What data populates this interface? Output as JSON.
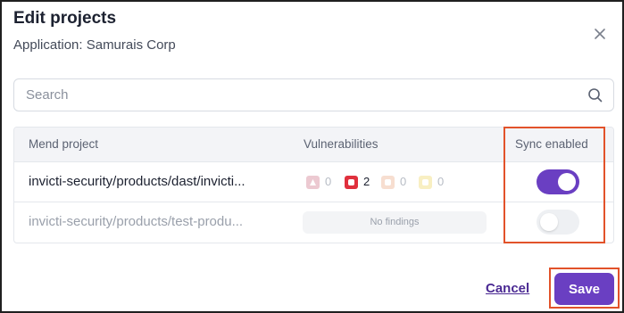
{
  "dialog": {
    "title": "Edit projects",
    "subtitle": "Application: Samurais Corp",
    "close_icon": "close-icon"
  },
  "search": {
    "placeholder": "Search",
    "value": "",
    "icon": "search-icon"
  },
  "table": {
    "columns": [
      "Mend project",
      "Vulnerabilities",
      "Sync enabled"
    ],
    "rows": [
      {
        "project": "invicti-security/products/dast/invicti...",
        "vulnerabilities": {
          "critical": "0",
          "high": "2",
          "medium": "0",
          "low": "0"
        },
        "no_findings": "",
        "sync_enabled": true
      },
      {
        "project": "invicti-security/products/test-produ...",
        "vulnerabilities": null,
        "no_findings": "No findings",
        "sync_enabled": false
      }
    ]
  },
  "footer": {
    "cancel_label": "Cancel",
    "save_label": "Save"
  },
  "colors": {
    "accent": "#6a3fc2",
    "highlight": "#e2522a",
    "high_severity": "#e0303d"
  }
}
